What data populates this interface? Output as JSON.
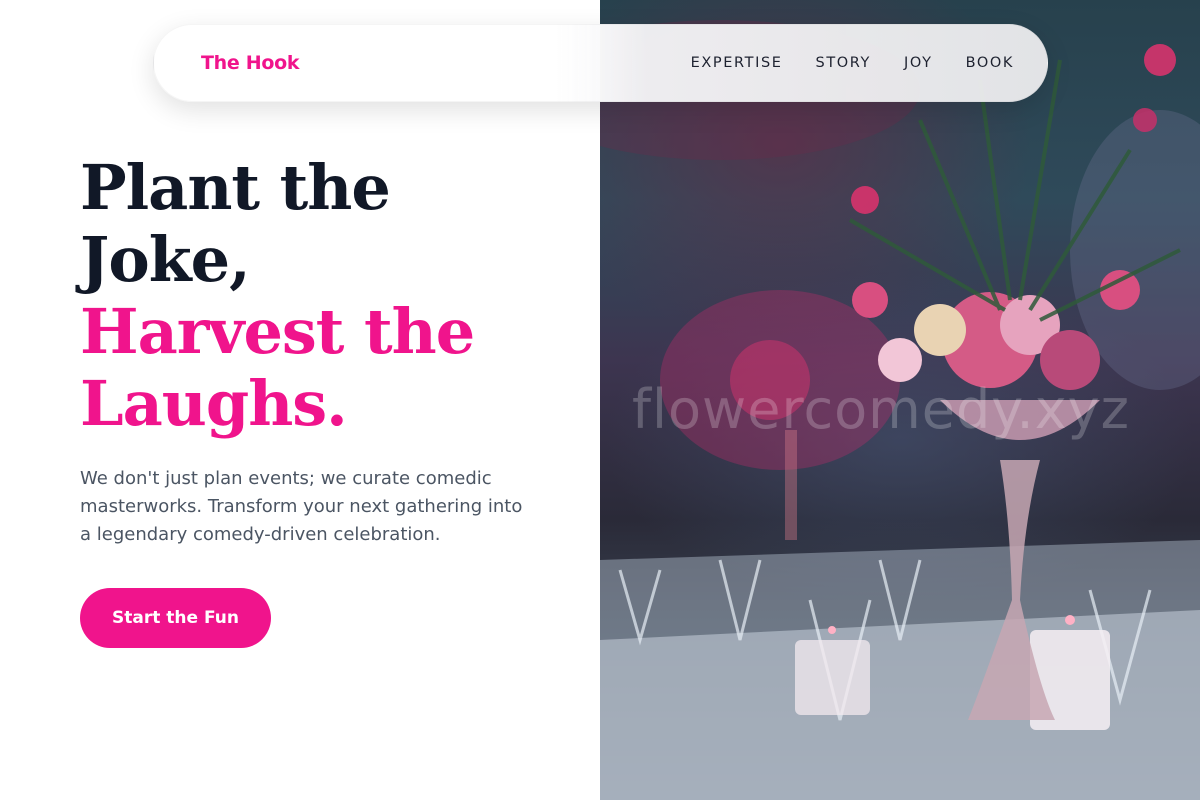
{
  "brand": {
    "name": "The Hook"
  },
  "nav": {
    "items": [
      {
        "label": "EXPERTISE"
      },
      {
        "label": "STORY"
      },
      {
        "label": "JOY"
      },
      {
        "label": "BOOK"
      }
    ]
  },
  "hero": {
    "title_line_1": "Plant the",
    "title_line_2": "Joke,",
    "title_line_3": "Harvest the",
    "title_line_4": "Laughs.",
    "description": "We don't just plan events; we curate comedic masterworks. Transform your next gathering into a legendary comedy-driven celebration.",
    "cta_label": "Start the Fun"
  },
  "photo": {
    "subject": "banquet table with flower centerpiece",
    "watermark": "flowercomedy.xyz"
  },
  "colors": {
    "accent": "#f0148c",
    "heading_dark": "#111827",
    "body_text": "#4b5563"
  }
}
